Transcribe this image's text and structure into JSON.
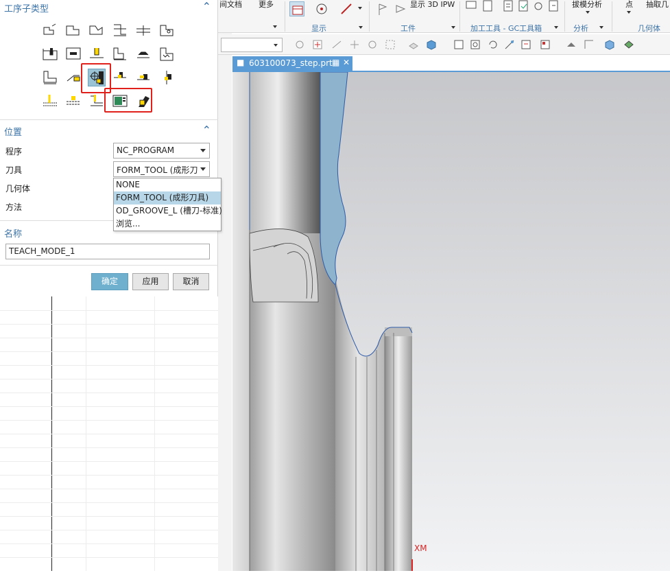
{
  "dialog": {
    "subtype_section_title": "工序子类型",
    "position_section_title": "位置",
    "name_section_title": "名称",
    "rows": {
      "program_label": "程序",
      "tool_label": "刀具",
      "geometry_label": "几何体",
      "method_label": "方法"
    },
    "program_value": "NC_PROGRAM",
    "tool_value": "FORM_TOOL (成形刀",
    "tool_options": [
      "NONE",
      "FORM_TOOL (成形刀具)",
      "OD_GROOVE_L (槽刀-标准)",
      "浏览..."
    ],
    "tool_selected_index": 1,
    "name_value": "TEACH_MODE_1",
    "buttons": {
      "ok": "确定",
      "apply": "应用",
      "cancel": "取消"
    }
  },
  "ribbon": {
    "items": {
      "doc": "间文档",
      "more": "更多",
      "show_3d_ipw": "显示 3D IPW",
      "draft_analysis": "拔模分析",
      "point": "点",
      "extract": "抽取几"
    },
    "groups": {
      "display": "显示",
      "workpiece": "工件",
      "machining_tools": "加工工具 - GC工具箱",
      "analysis": "分析",
      "geometry": "几何体"
    }
  },
  "document_tab": {
    "title": "603100073_step.prt"
  },
  "viewport": {
    "axis_label": "XM"
  },
  "colors": {
    "accent": "#3d74a8",
    "selection_red": "#e0201b",
    "tab_blue": "#5b9bd5",
    "primary_button": "#6fb0cf",
    "part_blue": "#8db4cc"
  }
}
